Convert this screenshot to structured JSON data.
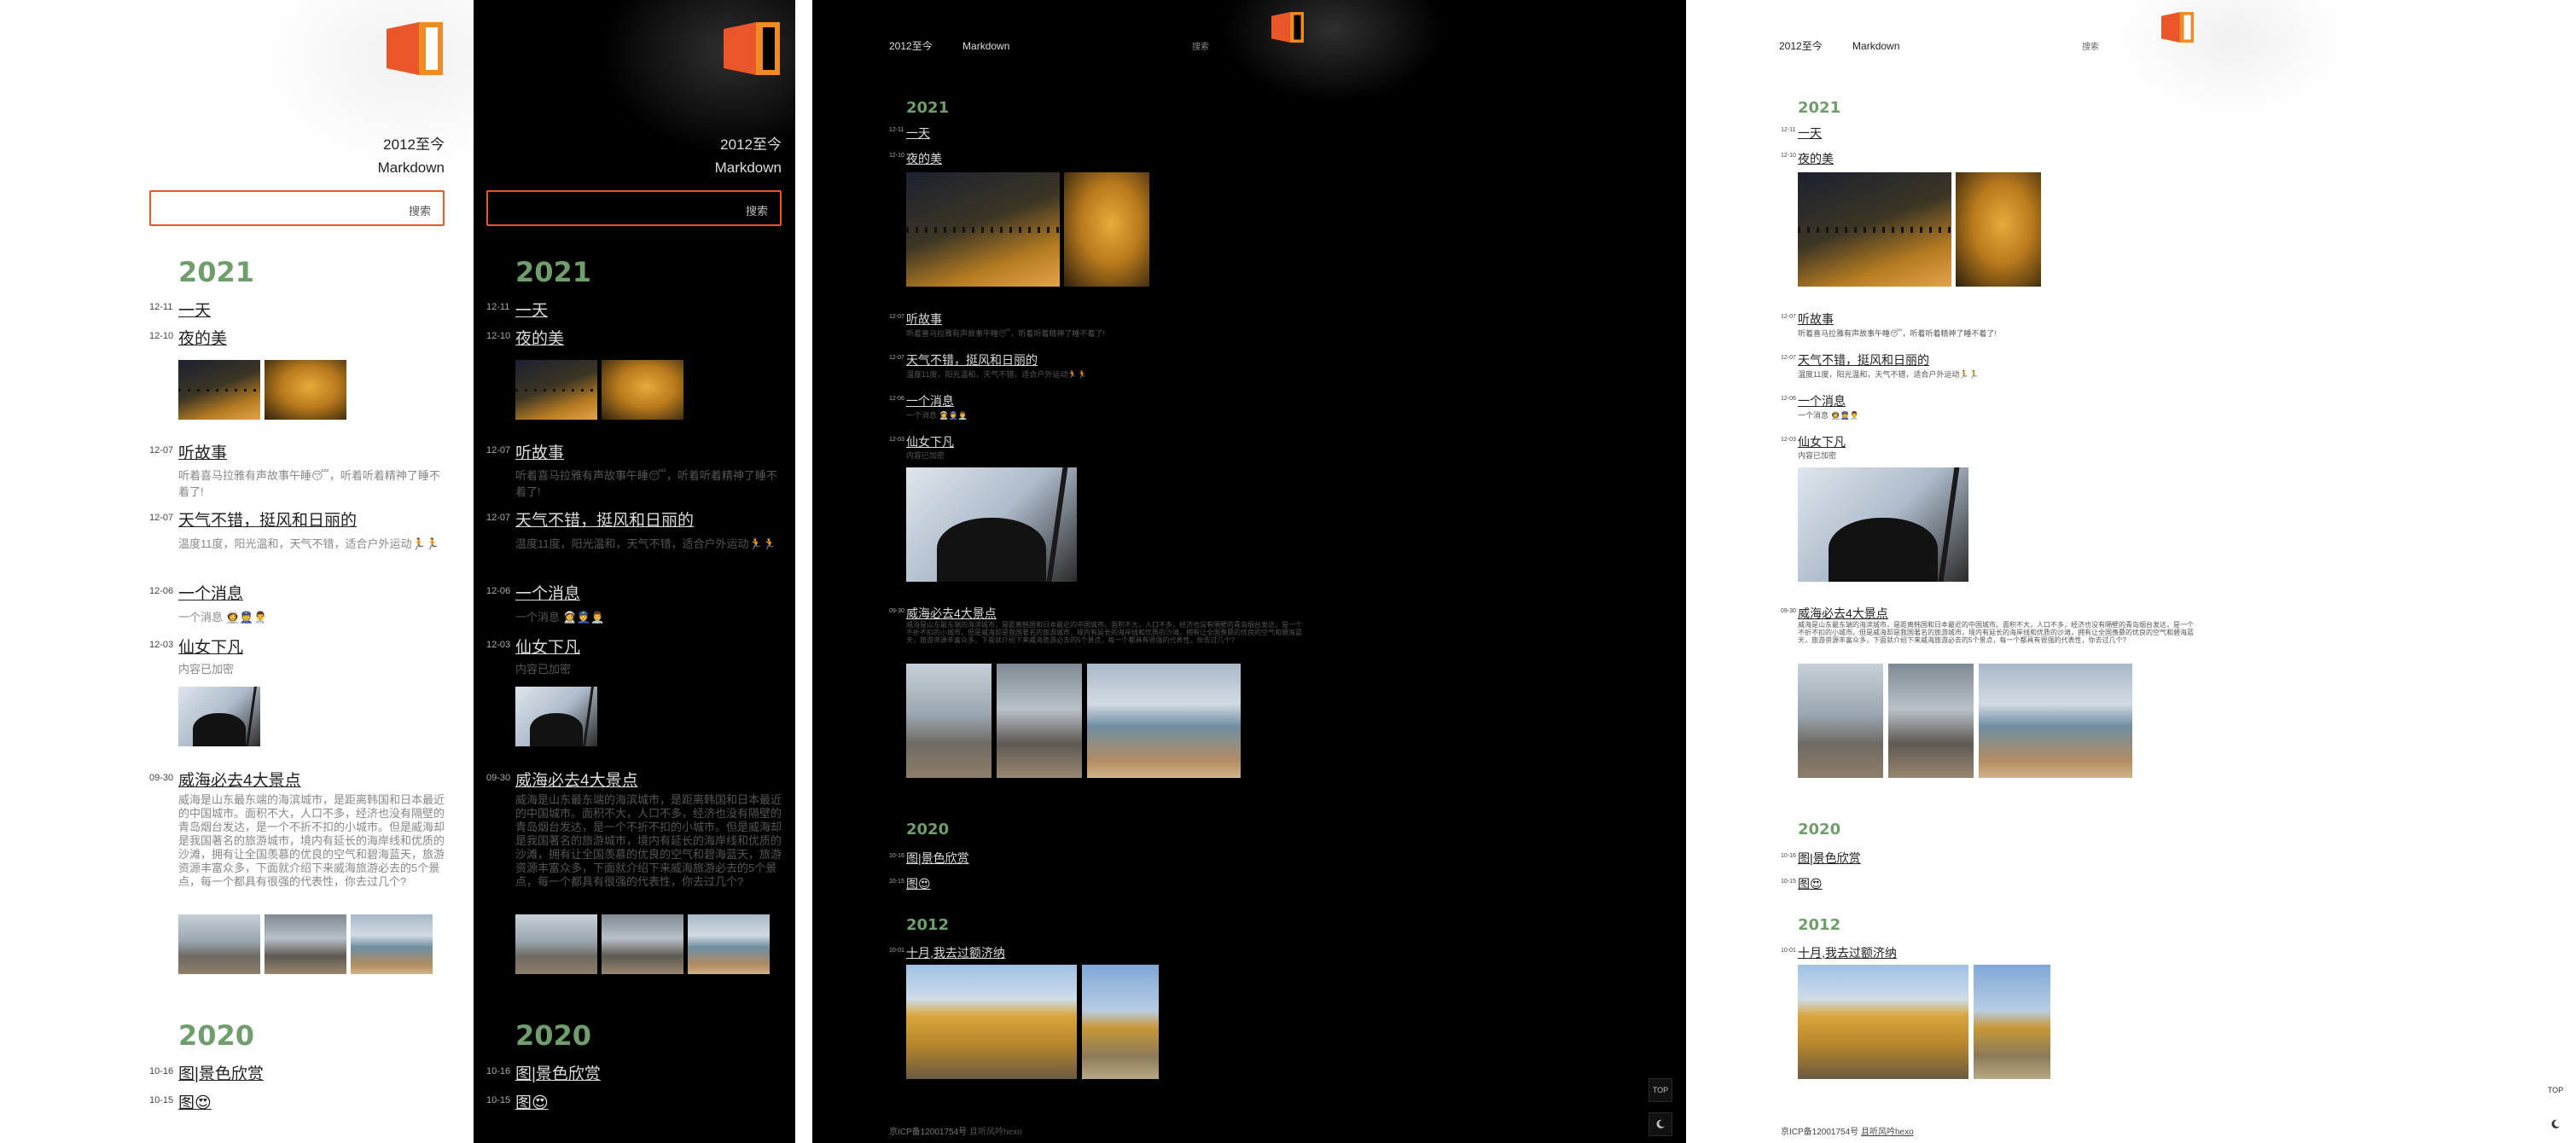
{
  "site": {
    "nav_range": "2012至今",
    "nav_markdown": "Markdown",
    "search_label": "搜索"
  },
  "years": [
    "2021",
    "2020",
    "2012"
  ],
  "posts_2021": [
    {
      "date": "12-11",
      "title": "一天",
      "desc": ""
    },
    {
      "date": "12-10",
      "title": "夜的美",
      "desc": ""
    },
    {
      "date": "12-07",
      "title": "听故事",
      "desc": "听着喜马拉雅有声故事午睡😴，听着听着精神了睡不着了!"
    },
    {
      "date": "12-07",
      "title": "天气不错，挺风和日丽的",
      "desc": "温度11度，阳光温和，天气不错，适合户外运动🏃‍🏃"
    },
    {
      "date": "12-06",
      "title": "一个消息",
      "desc": "一个消息 👩‍🚀👮👨‍⚕️"
    },
    {
      "date": "12-03",
      "title": "仙女下凡",
      "desc": "内容已加密"
    },
    {
      "date": "09-30",
      "title": "威海必去4大景点",
      "desc": "威海是山东最东端的海滨城市，是距离韩国和日本最近的中国城市。面积不大，人口不多，经济也没有隔壁的青岛烟台发达，是一个不折不扣的小城市。但是威海却是我国著名的旅游城市，境内有延长的海岸线和优质的沙滩，拥有让全国羡慕的优良的空气和碧海蓝天，旅游资源丰富众多，下面就介绍下来威海旅游必去的5个景点，每一个都具有很强的代表性，你去过几个?"
    }
  ],
  "posts_2020": [
    {
      "date": "10-16",
      "title": "图|景色欣赏"
    },
    {
      "date": "10-15",
      "title": "图😍"
    }
  ],
  "posts_2012": [
    {
      "date": "10-01",
      "title": "十月,我去过额济纳"
    }
  ],
  "footer": {
    "icp": "京ICP备12001754号",
    "credit": "且听风吟hexo"
  },
  "buttons": {
    "top": "TOP",
    "theme_icon": "moon-icon"
  },
  "colors": {
    "accent": "#e8562a",
    "year_green": "#6f9e6c",
    "dark_bg": "#000000"
  }
}
